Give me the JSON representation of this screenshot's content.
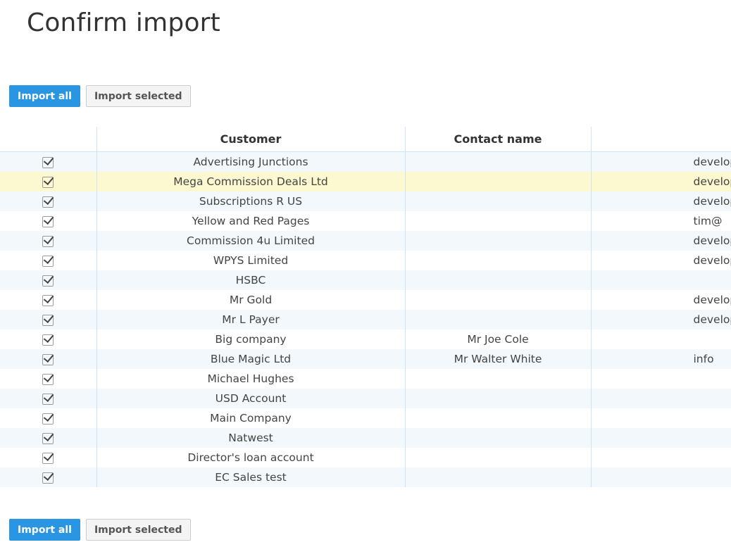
{
  "page": {
    "title": "Confirm import"
  },
  "actions": {
    "import_all_label": "Import all",
    "import_selected_label": "Import selected"
  },
  "table": {
    "columns": [
      "",
      "Customer",
      "Contact name",
      ""
    ],
    "rows": [
      {
        "checked": true,
        "customer": "Advertising Junctions",
        "contact": "",
        "email": "develop"
      },
      {
        "checked": true,
        "customer": "Mega Commission Deals Ltd",
        "contact": "",
        "email": "develop"
      },
      {
        "checked": true,
        "customer": "Subscriptions R US",
        "contact": "",
        "email": "develop"
      },
      {
        "checked": true,
        "customer": "Yellow and Red Pages",
        "contact": "",
        "email": "tim@"
      },
      {
        "checked": true,
        "customer": "Commission 4u Limited",
        "contact": "",
        "email": "develop"
      },
      {
        "checked": true,
        "customer": "WPYS Limited",
        "contact": "",
        "email": "develop"
      },
      {
        "checked": true,
        "customer": "HSBC",
        "contact": "",
        "email": ""
      },
      {
        "checked": true,
        "customer": "Mr Gold",
        "contact": "",
        "email": "develop"
      },
      {
        "checked": true,
        "customer": "Mr L Payer",
        "contact": "",
        "email": "develop"
      },
      {
        "checked": true,
        "customer": "Big company",
        "contact": "Mr Joe Cole",
        "email": ""
      },
      {
        "checked": true,
        "customer": "Blue Magic Ltd",
        "contact": "Mr Walter White",
        "email": "info"
      },
      {
        "checked": true,
        "customer": "Michael Hughes",
        "contact": "",
        "email": ""
      },
      {
        "checked": true,
        "customer": "USD Account",
        "contact": "",
        "email": ""
      },
      {
        "checked": true,
        "customer": "Main Company",
        "contact": "",
        "email": ""
      },
      {
        "checked": true,
        "customer": "Natwest",
        "contact": "",
        "email": ""
      },
      {
        "checked": true,
        "customer": "Director's loan account",
        "contact": "",
        "email": ""
      },
      {
        "checked": true,
        "customer": "EC Sales test",
        "contact": "",
        "email": ""
      }
    ],
    "highlighted_row": 1
  },
  "colors": {
    "primary": "#2a96e3",
    "row_stripe": "#f2f8fc",
    "row_highlight": "#fcf8cf",
    "grid_line": "#cfe3f2"
  }
}
